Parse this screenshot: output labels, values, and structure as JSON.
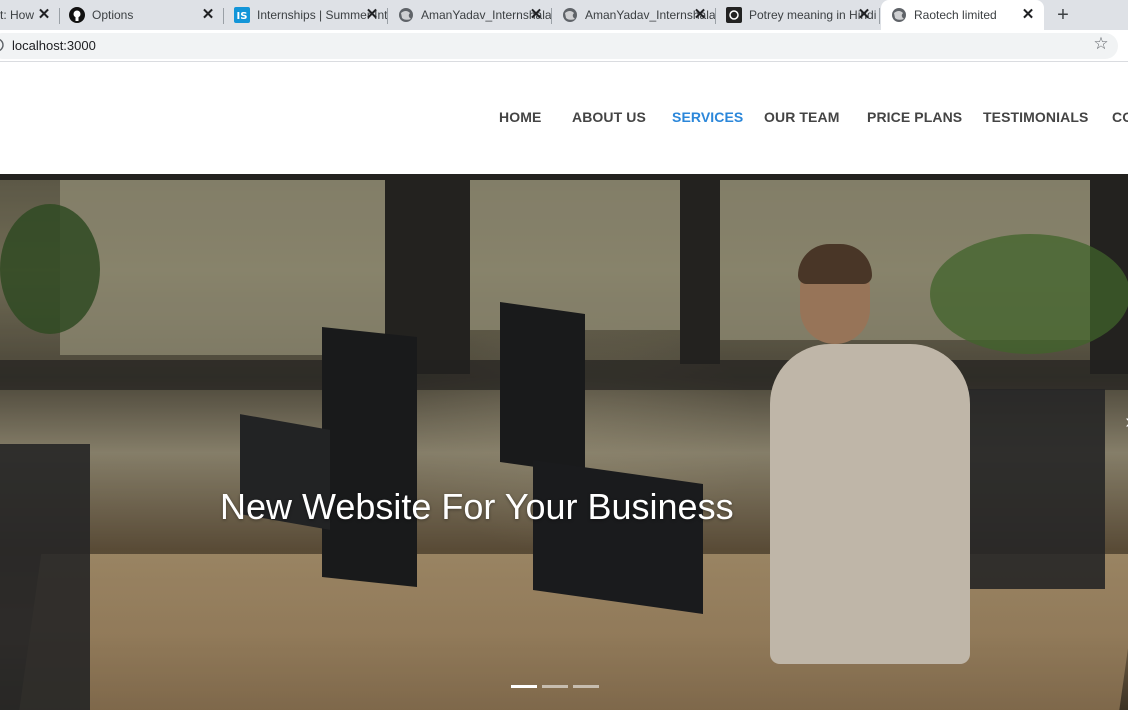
{
  "browser": {
    "tabs": [
      {
        "title": "t: How",
        "favicon": "page-icon",
        "active": false
      },
      {
        "title": "Options",
        "favicon": "github-icon",
        "active": false
      },
      {
        "title": "Internships | Summer Internships",
        "favicon": "internshala-icon",
        "active": false
      },
      {
        "title": "AmanYadav_Internshala",
        "favicon": "globe-icon",
        "active": false
      },
      {
        "title": "AmanYadav_Internshala",
        "favicon": "globe-icon",
        "active": false
      },
      {
        "title": "Potrey meaning in Hindi",
        "favicon": "dictionary-icon",
        "active": false
      },
      {
        "title": "Raotech limited",
        "favicon": "globe-icon",
        "active": true
      }
    ],
    "new_tab": "+",
    "close_glyph": "✕",
    "url": "localhost:3000"
  },
  "nav": {
    "items": [
      "HOME",
      "ABOUT US",
      "SERVICES",
      "OUR TEAM",
      "PRICE PLANS",
      "TESTIMONIALS",
      "CO"
    ],
    "active_index": 2
  },
  "hero": {
    "title": "New Website For Your Business",
    "slide_count": 3,
    "active_slide": 0
  },
  "colors": {
    "nav_active": "#2b87da",
    "nav_text": "#444444",
    "tabstrip": "#dee1e6"
  }
}
